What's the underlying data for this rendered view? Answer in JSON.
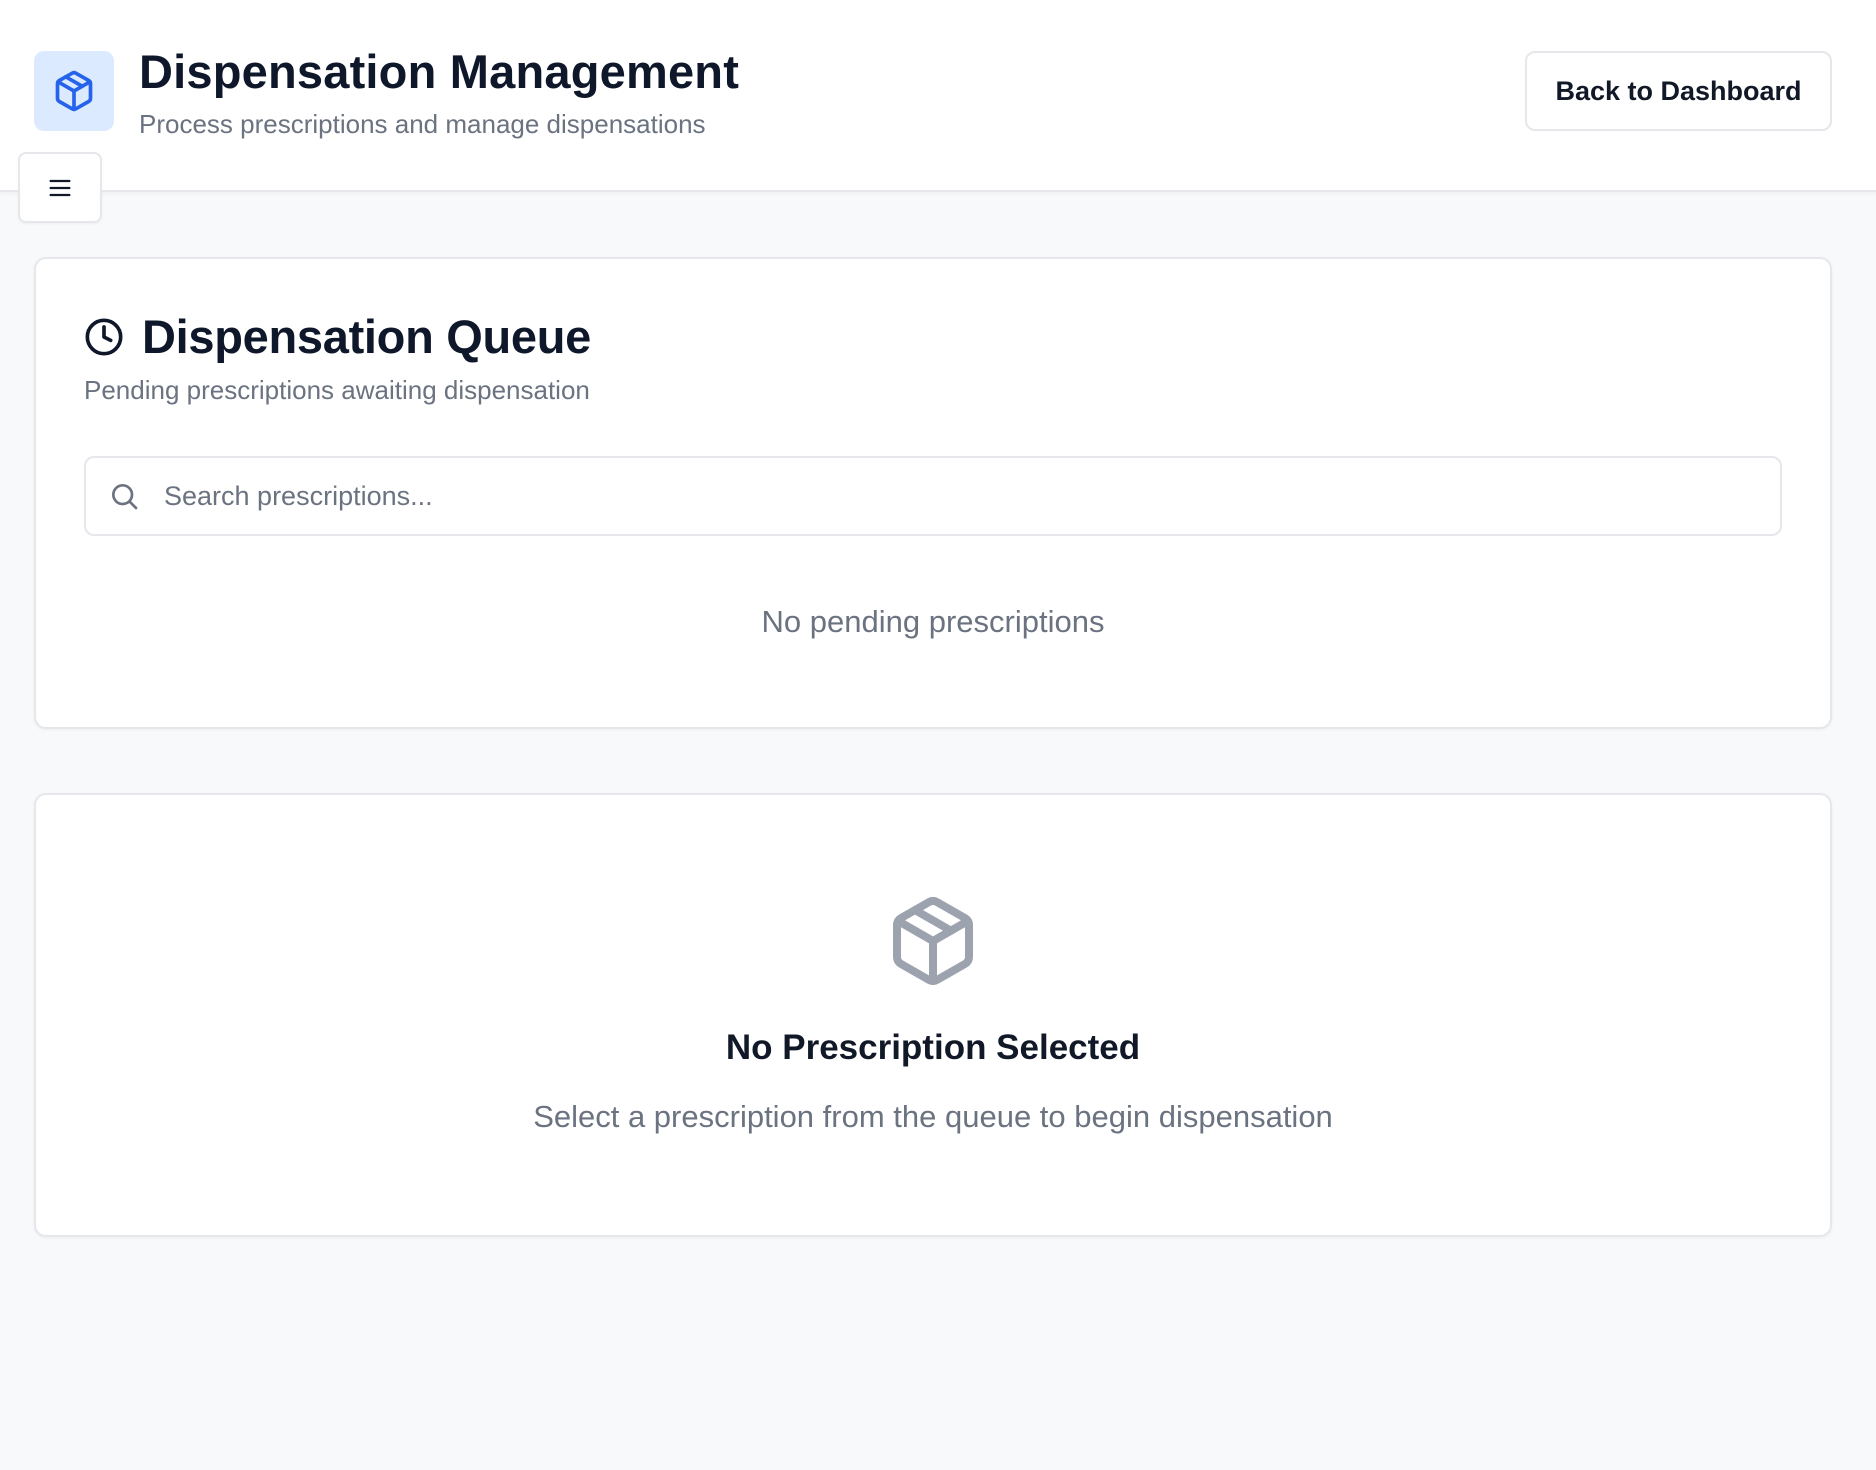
{
  "header": {
    "logo_icon": "package-icon",
    "title": "Dispensation Management",
    "subtitle": "Process prescriptions and manage dispensations",
    "back_button_label": "Back to Dashboard",
    "menu_icon": "hamburger-menu-icon",
    "accent_color": "#2563eb",
    "logo_bg_color": "#dbeafe"
  },
  "queue": {
    "icon": "clock-icon",
    "title": "Dispensation Queue",
    "description": "Pending prescriptions awaiting dispensation",
    "search": {
      "icon": "search-icon",
      "placeholder": "Search prescriptions...",
      "value": ""
    },
    "empty_message": "No pending prescriptions"
  },
  "detail": {
    "icon": "package-icon",
    "title": "No Prescription Selected",
    "description": "Select a prescription from the queue to begin dispensation"
  }
}
